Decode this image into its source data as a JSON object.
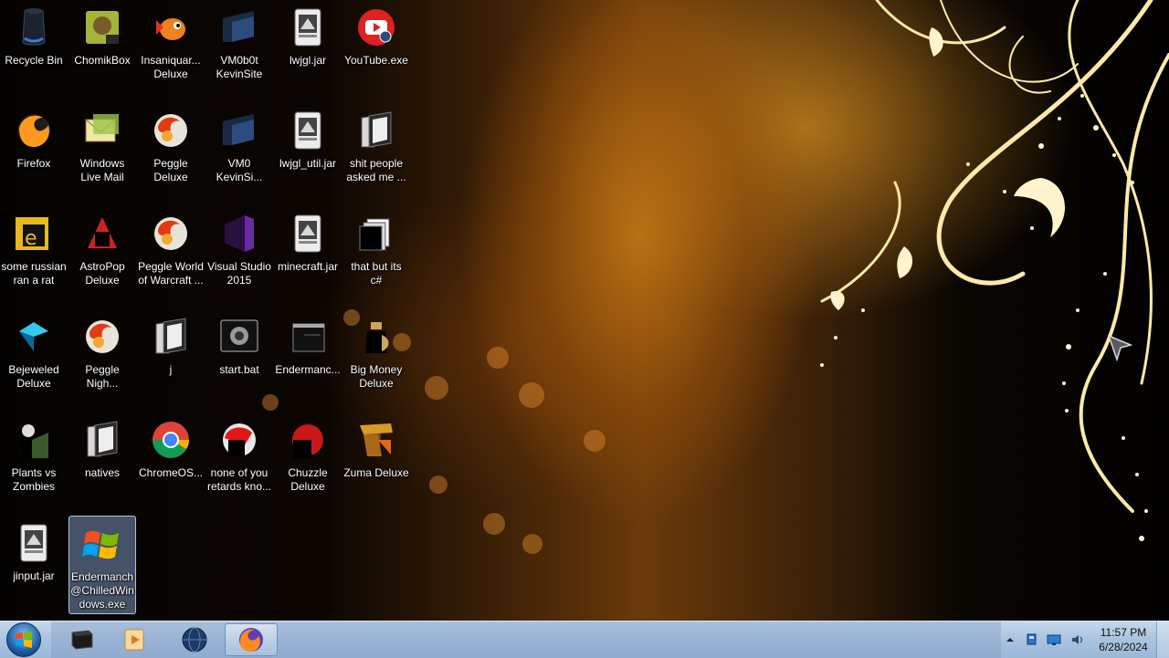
{
  "desktop": {
    "icons": [
      {
        "label": "Recycle Bin",
        "icon": "recycle-bin-icon"
      },
      {
        "label": "ChomikBox",
        "icon": "chomikbox-icon"
      },
      {
        "label": "Insaniquar...\nDeluxe",
        "icon": "insaniquarium-icon"
      },
      {
        "label": "VM0b0t\nKevinSite",
        "icon": "vm-shortcut-icon"
      },
      {
        "label": "lwjgl.jar",
        "icon": "jar-file-icon"
      },
      {
        "label": "YouTube.exe",
        "icon": "youtube-icon"
      },
      {
        "label": "Firefox",
        "icon": "firefox-icon"
      },
      {
        "label": "Windows\nLive Mail",
        "icon": "live-mail-icon"
      },
      {
        "label": "Peggle\nDeluxe",
        "icon": "peggle-icon"
      },
      {
        "label": "VM0\nKevinSi...",
        "icon": "vm-shortcut-icon"
      },
      {
        "label": "lwjgl_util.jar",
        "icon": "jar-file-icon"
      },
      {
        "label": "shit people\nasked me ...",
        "icon": "folder-icon"
      },
      {
        "label": "some russian\nran a rat",
        "icon": "folder-shortcut-icon"
      },
      {
        "label": "AstroPop\nDeluxe",
        "icon": "astropop-icon"
      },
      {
        "label": "Peggle World\nof Warcraft ...",
        "icon": "peggle-icon"
      },
      {
        "label": "Visual Studio\n2015",
        "icon": "visual-studio-icon"
      },
      {
        "label": "minecraft.jar",
        "icon": "jar-file-icon"
      },
      {
        "label": "that but its\nc#",
        "icon": "files-shortcut-icon"
      },
      {
        "label": "Bejeweled\nDeluxe",
        "icon": "bejeweled-icon"
      },
      {
        "label": "Peggle\nNigh...",
        "icon": "peggle-icon"
      },
      {
        "label": "j",
        "icon": "folder-icon"
      },
      {
        "label": "start.bat",
        "icon": "batch-file-icon"
      },
      {
        "label": "Endermanc...",
        "icon": "window-shortcut-icon"
      },
      {
        "label": "Big Money\nDeluxe",
        "icon": "big-money-icon"
      },
      {
        "label": "Plants vs\nZombies",
        "icon": "plants-vs-zombies-icon"
      },
      {
        "label": "natives",
        "icon": "folder-icon"
      },
      {
        "label": "ChromeOS...",
        "icon": "chrome-icon"
      },
      {
        "label": "none of you\nretards kno...",
        "icon": "red-shortcut-icon"
      },
      {
        "label": "Chuzzle\nDeluxe",
        "icon": "chuzzle-icon"
      },
      {
        "label": "Zuma Deluxe",
        "icon": "zuma-icon"
      },
      {
        "label": "jinput.jar",
        "icon": "jar-file-icon"
      },
      {
        "label": "Endermanch\n@ChilledWin\ndows.exe",
        "icon": "windows-xp-logo-icon"
      }
    ]
  },
  "taskbar": {
    "start_label": "Start",
    "apps": [
      {
        "icon": "terminal-window-icon",
        "active": false
      },
      {
        "icon": "media-player-icon",
        "active": false
      },
      {
        "icon": "globe-icon",
        "active": false
      },
      {
        "icon": "firefox-icon",
        "active": true
      }
    ],
    "tray": {
      "icons": [
        "show-hidden-icons-arrow",
        "network-status-icon",
        "display-icon",
        "speaker-icon"
      ],
      "time": "11:57 PM",
      "date": "6/28/2024"
    }
  },
  "colors": {
    "taskbar": "#a9c4e0",
    "wallpaper_gold": "#c47814",
    "selection": "#7896be"
  }
}
